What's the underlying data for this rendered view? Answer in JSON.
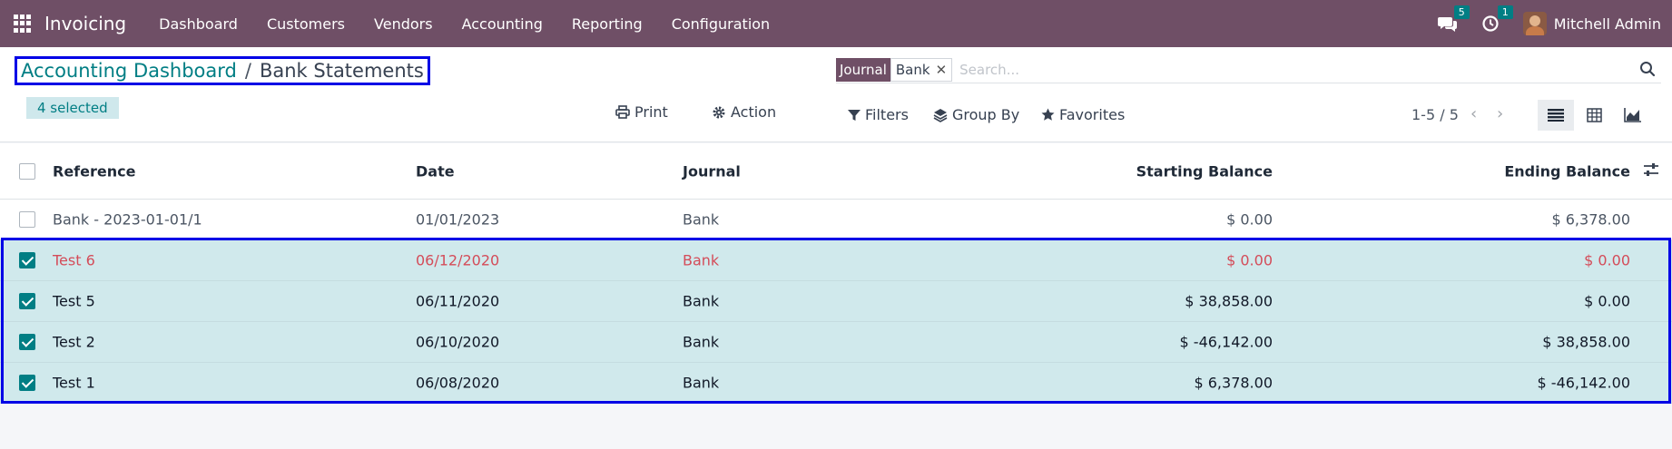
{
  "navbar": {
    "brand": "Invoicing",
    "menu": [
      "Dashboard",
      "Customers",
      "Vendors",
      "Accounting",
      "Reporting",
      "Configuration"
    ],
    "messages_count": "5",
    "activities_count": "1",
    "user_name": "Mitchell Admin"
  },
  "breadcrumb": {
    "parent": "Accounting Dashboard",
    "separator": "/",
    "current": "Bank Statements"
  },
  "selection": {
    "label": "4 selected"
  },
  "actions": {
    "print": "Print",
    "action": "Action"
  },
  "search": {
    "facet_label": "Journal",
    "facet_value": "Bank",
    "placeholder": "Search...",
    "filters": "Filters",
    "group_by": "Group By",
    "favorites": "Favorites"
  },
  "pager": {
    "value": "1-5 / 5"
  },
  "table": {
    "columns": {
      "reference": "Reference",
      "date": "Date",
      "journal": "Journal",
      "starting_balance": "Starting Balance",
      "ending_balance": "Ending Balance"
    },
    "rows": [
      {
        "reference": "Bank - 2023-01-01/1",
        "date": "01/01/2023",
        "journal": "Bank",
        "starting_balance": "$ 0.00",
        "ending_balance": "$ 6,378.00",
        "selected": false
      },
      {
        "reference": "Test 6",
        "date": "06/12/2020",
        "journal": "Bank",
        "starting_balance": "$ 0.00",
        "ending_balance": "$ 0.00",
        "selected": true
      },
      {
        "reference": "Test 5",
        "date": "06/11/2020",
        "journal": "Bank",
        "starting_balance": "$ 38,858.00",
        "ending_balance": "$ 0.00",
        "selected": true
      },
      {
        "reference": "Test 2",
        "date": "06/10/2020",
        "journal": "Bank",
        "starting_balance": "$ -46,142.00",
        "ending_balance": "$ 38,858.00",
        "selected": true
      },
      {
        "reference": "Test 1",
        "date": "06/08/2020",
        "journal": "Bank",
        "starting_balance": "$ 6,378.00",
        "ending_balance": "$ -46,142.00",
        "selected": true
      }
    ]
  },
  "colors": {
    "navbar": "#6f4f66",
    "accent": "#017e84",
    "selected_row": "#d0e9ec",
    "danger_text": "#d44c59",
    "highlight_frame": "#0000e6"
  }
}
